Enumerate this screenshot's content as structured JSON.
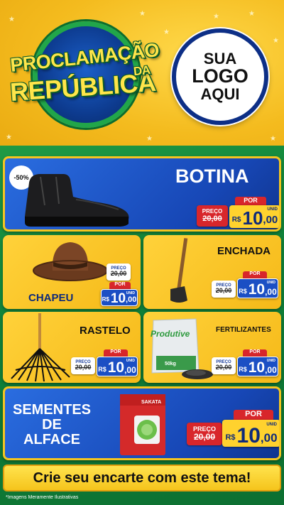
{
  "header": {
    "title_line1": "PROCLAMAÇÃO",
    "title_line2": "REPÚBLICA",
    "title_da": "DA",
    "logo_line1": "SUA",
    "logo_line2": "LOGO",
    "logo_line3": "AQUI"
  },
  "products": {
    "botina": {
      "name": "BOTINA",
      "discount": "-50%",
      "old_label": "PREÇO",
      "old_price": "20,00",
      "por": "POR",
      "currency": "R$",
      "price_int": "10",
      "price_dec": ",00",
      "unit": "UNID"
    },
    "chapeu": {
      "name": "CHAPEU",
      "old_label": "PREÇO",
      "old_price": "20,00",
      "por": "POR",
      "currency": "R$",
      "price_int": "10",
      "price_dec": ",00",
      "unit": "UNID"
    },
    "enchada": {
      "name": "ENCHADA",
      "old_label": "PREÇO",
      "old_price": "20,00",
      "por": "POR",
      "currency": "R$",
      "price_int": "10",
      "price_dec": ",00",
      "unit": "UNID"
    },
    "rastelo": {
      "name": "RASTELO",
      "old_label": "PREÇO",
      "old_price": "20,00",
      "por": "POR",
      "currency": "R$",
      "price_int": "10",
      "price_dec": ",00",
      "unit": "UNID"
    },
    "fertilizantes": {
      "name": "FERTILIZANTES",
      "bag_brand": "Produtive",
      "bag_weight": "50kg",
      "old_label": "PREÇO",
      "old_price": "20,00",
      "por": "POR",
      "currency": "R$",
      "price_int": "10",
      "price_dec": ",00",
      "unit": "UNID"
    },
    "sementes": {
      "name_line1": "SEMENTES",
      "name_line2": "DE",
      "name_line3": "ALFACE",
      "pack_brand": "SAKATA",
      "old_label": "PREÇO",
      "old_price": "20,00",
      "por": "POR",
      "currency": "R$",
      "price_int": "10",
      "price_dec": ",00",
      "unit": "UNID"
    }
  },
  "footer": {
    "cta": "Crie seu encarte com este tema!",
    "note": "*Imagens Meramente Ilustrativas"
  },
  "colors": {
    "background_yellow": "#f2b81c",
    "background_green": "#11823a",
    "panel_blue": "#1747b6",
    "price_red": "#d8262b",
    "price_yellow": "#ffd22e"
  }
}
